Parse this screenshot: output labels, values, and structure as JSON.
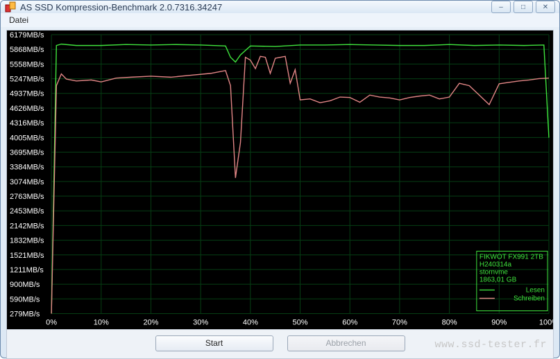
{
  "window": {
    "title": "AS SSD Kompression-Benchmark 2.0.7316.34247"
  },
  "menubar": {
    "items": [
      "Datei"
    ]
  },
  "chart_data": {
    "type": "line",
    "title": "",
    "xlabel": "",
    "ylabel": "",
    "x_unit": "%",
    "y_unit": "MB/s",
    "xlim": [
      0,
      100
    ],
    "ylim": [
      279,
      6179
    ],
    "x_ticks": [
      0,
      10,
      20,
      30,
      40,
      50,
      60,
      70,
      80,
      90,
      100
    ],
    "y_ticks_labels": [
      "6179MB/s",
      "5868MB/s",
      "5558MB/s",
      "5247MB/s",
      "4937MB/s",
      "4626MB/s",
      "4316MB/s",
      "4005MB/s",
      "3695MB/s",
      "3384MB/s",
      "3074MB/s",
      "2763MB/s",
      "2453MB/s",
      "2142MB/s",
      "1832MB/s",
      "1521MB/s",
      "1211MB/s",
      "900MB/s",
      "590MB/s",
      "279MB/s"
    ],
    "y_ticks_values": [
      6179,
      5868,
      5558,
      5247,
      4937,
      4626,
      4316,
      4005,
      3695,
      3384,
      3074,
      2763,
      2453,
      2142,
      1832,
      1521,
      1211,
      900,
      590,
      279
    ],
    "series": [
      {
        "name": "Lesen",
        "color": "#3fe53d",
        "x": [
          0,
          1,
          2,
          5,
          10,
          15,
          20,
          25,
          30,
          35,
          36,
          37,
          38,
          40,
          45,
          50,
          55,
          60,
          65,
          70,
          75,
          80,
          85,
          90,
          95,
          99,
          100
        ],
        "values": [
          279,
          5950,
          5980,
          5950,
          5950,
          5970,
          5960,
          5970,
          5960,
          5940,
          5700,
          5600,
          5750,
          5940,
          5930,
          5960,
          5960,
          5970,
          5960,
          5950,
          5950,
          5970,
          5950,
          5960,
          5950,
          5960,
          4000
        ]
      },
      {
        "name": "Schreiben",
        "color": "#e38686",
        "x": [
          0,
          1,
          2,
          3,
          5,
          8,
          10,
          13,
          16,
          20,
          24,
          28,
          32,
          35,
          36,
          37,
          38,
          39,
          40,
          41,
          42,
          43,
          44,
          45,
          46,
          47,
          48,
          49,
          50,
          52,
          54,
          56,
          58,
          60,
          62,
          64,
          66,
          68,
          70,
          72,
          74,
          76,
          78,
          80,
          82,
          84,
          86,
          88,
          90,
          92,
          94,
          96,
          98,
          100
        ],
        "values": [
          279,
          5100,
          5350,
          5240,
          5200,
          5220,
          5180,
          5260,
          5280,
          5300,
          5280,
          5320,
          5360,
          5420,
          5100,
          3150,
          3900,
          5700,
          5640,
          5460,
          5720,
          5700,
          5360,
          5680,
          5700,
          5720,
          5150,
          5440,
          4800,
          4820,
          4740,
          4780,
          4860,
          4850,
          4750,
          4900,
          4860,
          4840,
          4800,
          4850,
          4880,
          4900,
          4820,
          4860,
          5150,
          5100,
          4900,
          4700,
          5140,
          5170,
          5200,
          5220,
          5250,
          5260
        ]
      }
    ],
    "legend": {
      "position": "bottom-right",
      "device": "FIKWOT FX991 2TB",
      "model": "H240314a",
      "driver": "stornvme",
      "capacity": "1863,01 GB",
      "entries": [
        {
          "name": "Lesen",
          "color": "#3fe53d"
        },
        {
          "name": "Schreiben",
          "color": "#e38686"
        }
      ]
    }
  },
  "buttons": {
    "start": "Start",
    "abort": "Abbrechen"
  },
  "watermark": "www.ssd-tester.fr"
}
